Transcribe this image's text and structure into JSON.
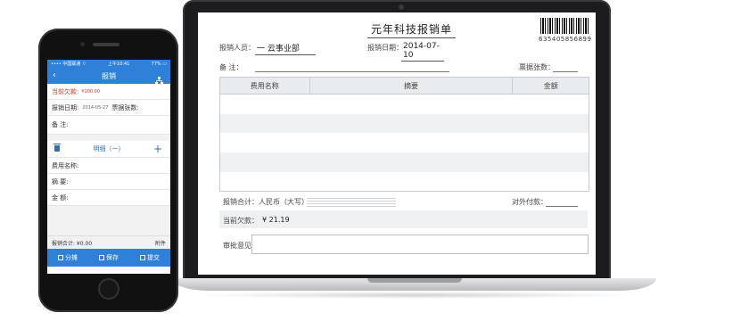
{
  "laptop_form": {
    "title": "元年科技报销单",
    "barcode_number": "635405856899",
    "applicant_label": "报销人员：",
    "applicant_value": "一 云事业部",
    "date_label": "报销日期：",
    "date_value": "2014-07-10",
    "remark_label": "备    注：",
    "invoice_count_label": "票据张数：",
    "table_headers": [
      "费用名称",
      "摘要",
      "金额"
    ],
    "total_label": "报销合计：",
    "total_currency_label": "人民币（大写）",
    "external_payment_label": "对外付款：",
    "current_debt_label": "当前欠款：",
    "current_debt_value": "¥ 21.19",
    "approval_label": "审批意见："
  },
  "phone": {
    "status_left": "•••• 中国联通 ⌔",
    "status_time": "上午10:41",
    "status_right": "77% ▭",
    "nav_title": "报销",
    "current_debt_label": "当前欠款:",
    "current_debt_value": "¥100.00",
    "date_label": "报销日期:",
    "date_value": "2014-05-27",
    "invoice_label": "票据张数:",
    "remark_label": "备      注:",
    "detail_title": "明细（一）",
    "expense_name_label": "费用名称:",
    "summary_label": "摘      要:",
    "amount_label": "金      额:",
    "total_label": "报销合计: ¥0.00",
    "attachment_label": "附件",
    "footer": {
      "split_label": "分摊",
      "save_label": "保存",
      "submit_label": "提交"
    }
  }
}
